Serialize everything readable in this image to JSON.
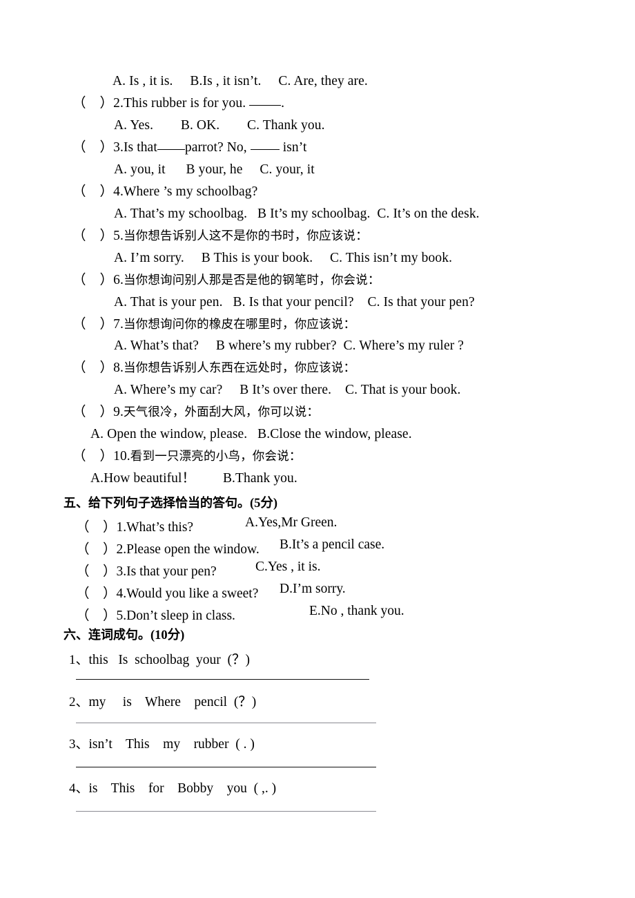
{
  "document": {
    "language": "zh-en",
    "paper_type": "english-exam-worksheet"
  },
  "multiple_choice_continued": {
    "q1_options": "A. Is , it is.     B.Is , it isn’t.     C. Are, they are.",
    "items": [
      {
        "marker": "（    ）",
        "number": "2.",
        "stem_before_blank": "This rubber is for you. ",
        "stem_after_blank": ".",
        "options": "A. Yes.        B. OK.        C. Thank you."
      },
      {
        "marker": "（    ）",
        "number": "3.",
        "stem_part1": "Is that",
        "stem_part2": "parrot? No, ",
        "stem_part3": " isn’t",
        "options": "A. you, it      B your, he     C. your, it"
      },
      {
        "marker": "（    ）",
        "number": "4.",
        "stem": "Where ’s my schoolbag?",
        "options": "A. That’s my schoolbag.   B It’s my schoolbag.  C. It’s on the desk."
      },
      {
        "marker": "（    ）",
        "number": "5.",
        "stem": "当你想告诉别人这不是你的书时，你应该说：",
        "options": "A. I’m sorry.     B This is your book.     C. This isn’t my book."
      },
      {
        "marker": "（    ）",
        "number": "6.",
        "stem": "当你想询问别人那是否是他的钢笔时，你会说：",
        "options": "A. That is your pen.   B. Is that your pencil?    C. Is that your pen?"
      },
      {
        "marker": "（    ）",
        "number": "7.",
        "stem": "当你想询问你的橡皮在哪里时，你应该说：",
        "options": "A. What’s that?     B where’s my rubber?  C. Where’s my ruler ?"
      },
      {
        "marker": "（    ）",
        "number": "8.",
        "stem": "当你想告诉别人东西在远处时，你应该说：",
        "options": "A. Where’s my car?     B It’s over there.    C. That is your book."
      },
      {
        "marker": "（    ）",
        "number": "9.",
        "stem": "天气很冷，外面刮大风，你可以说：",
        "options": "A. Open the window, please.   B.Close the window, please."
      },
      {
        "marker": "（    ）",
        "number": "10.",
        "stem": "看到一只漂亮的小鸟，你会说：",
        "options": "A.How beautiful！        B.Thank you."
      }
    ]
  },
  "section_five": {
    "heading_cn": "五、给下列句子选择恰当的答句。",
    "heading_score": "(5分)",
    "items": [
      {
        "marker": "（    ）",
        "number": "1.",
        "stem": "What’s this?",
        "answer": "A.Yes,Mr Green."
      },
      {
        "marker": "（    ）",
        "number": "2.",
        "stem": "Please open the window.",
        "answer": "B.It’s a pencil case."
      },
      {
        "marker": "（    ）",
        "number": "3.",
        "stem": "Is that your pen?",
        "answer": "C.Yes , it is."
      },
      {
        "marker": "（    ）",
        "number": "4.",
        "stem": "Would you like a sweet?",
        "answer": "D.I’m sorry."
      },
      {
        "marker": "（    ）",
        "number": "5.",
        "stem": "Don’t sleep in class.",
        "answer": "E.No , thank you."
      }
    ]
  },
  "section_six": {
    "heading_cn": "六、连词成句。",
    "heading_score": "(10分)",
    "items": [
      {
        "number": "1、",
        "words": "this   Is  schoolbag  your  (？)"
      },
      {
        "number": "2、",
        "words": "my     is    Where    pencil  (？)"
      },
      {
        "number": "3、",
        "words": "isn’t    This    my    rubber  ( . )"
      },
      {
        "number": "4、",
        "words": "is    This    for    Bobby    you  ( ,. )"
      }
    ]
  }
}
